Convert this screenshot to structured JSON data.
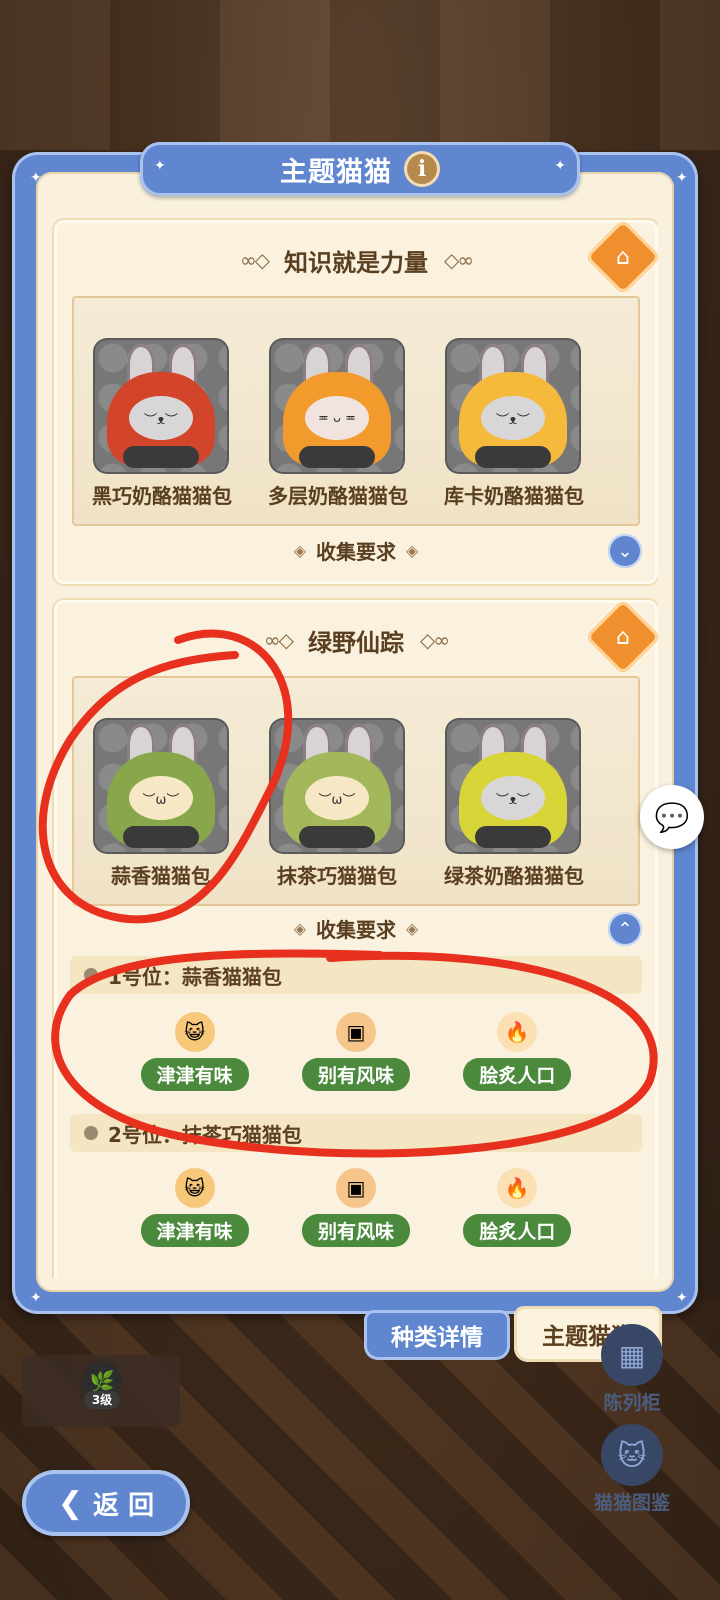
{
  "panel": {
    "title": "主题猫猫",
    "info_icon": "i"
  },
  "sets": [
    {
      "title": "知识就是力量",
      "cats": [
        {
          "name": "黑巧奶酪猫猫包",
          "color": "#d3452a"
        },
        {
          "name": "多层奶酪猫猫包",
          "color": "#f29a2c"
        },
        {
          "name": "库卡奶酪猫猫包",
          "color": "#f5b93b"
        }
      ],
      "collect_label": "收集要求"
    },
    {
      "title": "绿野仙踪",
      "cats": [
        {
          "name": "蒜香猫猫包",
          "color": "#88a64a"
        },
        {
          "name": "抹茶巧猫猫包",
          "color": "#a3b85a"
        },
        {
          "name": "绿茶奶酪猫猫包",
          "color": "#d7d538"
        }
      ],
      "collect_label": "收集要求",
      "requirements": [
        {
          "label": "1号位：蒜香猫猫包",
          "tags": [
            "津津有味",
            "别有风味",
            "脍炙人口"
          ]
        },
        {
          "label": "2号位：抹茶巧猫猫包",
          "tags": [
            "津津有味",
            "别有风味",
            "脍炙人口"
          ]
        }
      ]
    }
  ],
  "tabs": {
    "types": "种类详情",
    "theme": "主题猫猫"
  },
  "level": {
    "badge": "3级"
  },
  "side": {
    "display_cabinet": "陈列柜",
    "cat_catalog": "猫猫图鉴"
  },
  "back": {
    "label": "返 回"
  },
  "colors": {
    "panel_blue": "#5f86cf",
    "tag_green": "#4b8a3c",
    "annotation_red": "#e8301e"
  }
}
